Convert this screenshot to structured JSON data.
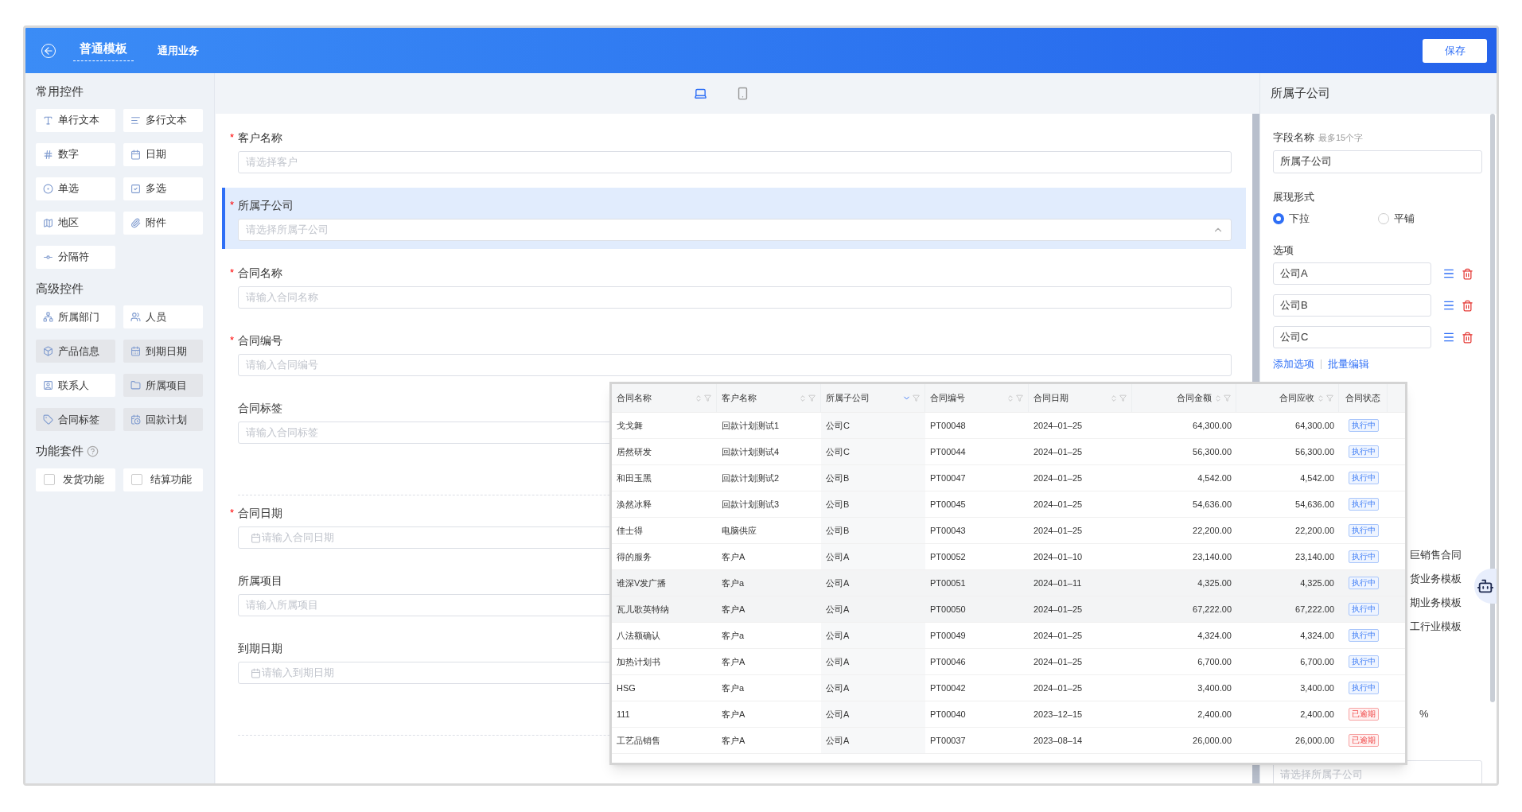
{
  "header": {
    "title": "普通模板",
    "subtitle": "通用业务",
    "save_button": "保存"
  },
  "sidebar": {
    "groups": [
      {
        "title": "常用控件",
        "help": false,
        "kind": "button",
        "items": [
          {
            "label": "单行文本",
            "disabled": false
          },
          {
            "label": "多行文本",
            "disabled": false
          },
          {
            "label": "数字",
            "disabled": false
          },
          {
            "label": "日期",
            "disabled": false
          },
          {
            "label": "单选",
            "disabled": false
          },
          {
            "label": "多选",
            "disabled": false
          },
          {
            "label": "地区",
            "disabled": false
          },
          {
            "label": "附件",
            "disabled": false
          },
          {
            "label": "分隔符",
            "disabled": false
          }
        ]
      },
      {
        "title": "高级控件",
        "help": false,
        "kind": "button",
        "items": [
          {
            "label": "所属部门",
            "disabled": false
          },
          {
            "label": "人员",
            "disabled": false
          },
          {
            "label": "产品信息",
            "disabled": true
          },
          {
            "label": "到期日期",
            "disabled": true
          },
          {
            "label": "联系人",
            "disabled": false
          },
          {
            "label": "所属项目",
            "disabled": true
          },
          {
            "label": "合同标签",
            "disabled": true
          },
          {
            "label": "回款计划",
            "disabled": true
          }
        ]
      },
      {
        "title": "功能套件",
        "help": true,
        "kind": "checkbox",
        "items": [
          {
            "label": "发货功能",
            "checked": false
          },
          {
            "label": "结算功能",
            "checked": false
          }
        ]
      }
    ]
  },
  "view_modes": [
    {
      "kind": "desktop",
      "selected": true
    },
    {
      "kind": "mobile",
      "selected": false
    }
  ],
  "form": {
    "fields": [
      {
        "kind": "input",
        "label": "客户名称",
        "required_mark": "*",
        "placeholder": "请选择客户",
        "selected": false
      },
      {
        "kind": "select",
        "label": "所属子公司",
        "required_mark": "*",
        "placeholder": "请选择所属子公司",
        "selected": true
      },
      {
        "kind": "input",
        "label": "合同名称",
        "required_mark": "*",
        "placeholder": "请输入合同名称",
        "selected": false
      },
      {
        "kind": "input",
        "label": "合同编号",
        "required_mark": "*",
        "placeholder": "请输入合同编号",
        "selected": false
      },
      {
        "kind": "input",
        "label": "合同标签",
        "placeholder": "请输入合同标签",
        "selected": false
      },
      {
        "kind": "divider"
      },
      {
        "kind": "date",
        "label": "合同日期",
        "required_mark": "*",
        "placeholder": "请输入合同日期",
        "selected": false
      },
      {
        "kind": "input",
        "label": "所属项目",
        "placeholder": "请输入所属项目",
        "selected": false
      },
      {
        "kind": "date",
        "label": "到期日期",
        "placeholder": "请输入到期日期",
        "selected": false
      },
      {
        "kind": "divider"
      }
    ]
  },
  "properties": {
    "title": "所属子公司",
    "field_name_label": "字段名称",
    "field_name_hint": "最多15个字",
    "field_name_value": "所属子公司",
    "display_label": "展现形式",
    "display_options": [
      {
        "label": "下拉",
        "selected": true
      },
      {
        "label": "平铺",
        "selected": false
      }
    ],
    "options_label": "选项",
    "options": [
      "公司A",
      "公司B",
      "公司C"
    ],
    "add_option": "添加选项",
    "batch_edit": "批量编辑",
    "partial_texts": [
      "巨销售合同",
      "货业务模板",
      "期业务模板",
      "工行业模板"
    ],
    "partial_percent": "%",
    "bottom_placeholder": "请选择所属子公司"
  },
  "table": {
    "columns": [
      {
        "label": "合同名称",
        "kind": "text",
        "sorted": false
      },
      {
        "label": "客户名称",
        "kind": "text",
        "sorted": false
      },
      {
        "label": "所属子公司",
        "kind": "text",
        "sorted": true
      },
      {
        "label": "合同编号",
        "kind": "text",
        "sorted": false
      },
      {
        "label": "合同日期",
        "kind": "text",
        "sorted": false
      },
      {
        "label": "合同金额",
        "kind": "number",
        "sorted": false
      },
      {
        "label": "合同应收",
        "kind": "number",
        "sorted": false
      },
      {
        "label": "合同状态",
        "kind": "status"
      }
    ],
    "rows": [
      {
        "highlighted": false,
        "cells": [
          "戈戈舞",
          "回款计划测试1",
          "公司C",
          "PT00048",
          "2024–01–25",
          "64,300.00",
          "64,300.00"
        ],
        "status": {
          "text": "执行中",
          "kind": "active"
        }
      },
      {
        "highlighted": false,
        "cells": [
          "居然研发",
          "回款计划测试4",
          "公司C",
          "PT00044",
          "2024–01–25",
          "56,300.00",
          "56,300.00"
        ],
        "status": {
          "text": "执行中",
          "kind": "active"
        }
      },
      {
        "highlighted": false,
        "cells": [
          "和田玉黑",
          "回款计划测试2",
          "公司B",
          "PT00047",
          "2024–01–25",
          "4,542.00",
          "4,542.00"
        ],
        "status": {
          "text": "执行中",
          "kind": "active"
        }
      },
      {
        "highlighted": false,
        "cells": [
          "涣然冰释",
          "回款计划测试3",
          "公司B",
          "PT00045",
          "2024–01–25",
          "54,636.00",
          "54,636.00"
        ],
        "status": {
          "text": "执行中",
          "kind": "active"
        }
      },
      {
        "highlighted": false,
        "cells": [
          "佳士得",
          "电脑供应",
          "公司B",
          "PT00043",
          "2024–01–25",
          "22,200.00",
          "22,200.00"
        ],
        "status": {
          "text": "执行中",
          "kind": "active"
        }
      },
      {
        "highlighted": false,
        "cells": [
          "得的服务",
          "客户A",
          "公司A",
          "PT00052",
          "2024–01–10",
          "23,140.00",
          "23,140.00"
        ],
        "status": {
          "text": "执行中",
          "kind": "active"
        }
      },
      {
        "highlighted": true,
        "cells": [
          "谁深V发广播",
          "客户a",
          "公司A",
          "PT00051",
          "2024–01–11",
          "4,325.00",
          "4,325.00"
        ],
        "status": {
          "text": "执行中",
          "kind": "active"
        }
      },
      {
        "highlighted": true,
        "cells": [
          "瓦儿歌英特纳",
          "客户A",
          "公司A",
          "PT00050",
          "2024–01–25",
          "67,222.00",
          "67,222.00"
        ],
        "status": {
          "text": "执行中",
          "kind": "active"
        }
      },
      {
        "highlighted": false,
        "cells": [
          "八法额确认",
          "客户a",
          "公司A",
          "PT00049",
          "2024–01–25",
          "4,324.00",
          "4,324.00"
        ],
        "status": {
          "text": "执行中",
          "kind": "active"
        }
      },
      {
        "highlighted": false,
        "cells": [
          "加热计划书",
          "客户A",
          "公司A",
          "PT00046",
          "2024–01–25",
          "6,700.00",
          "6,700.00"
        ],
        "status": {
          "text": "执行中",
          "kind": "active"
        }
      },
      {
        "highlighted": false,
        "cells": [
          "HSG",
          "客户a",
          "公司A",
          "PT00042",
          "2024–01–25",
          "3,400.00",
          "3,400.00"
        ],
        "status": {
          "text": "执行中",
          "kind": "active"
        }
      },
      {
        "highlighted": false,
        "cells": [
          "111",
          "客户A",
          "公司A",
          "PT00040",
          "2023–12–15",
          "2,400.00",
          "2,400.00"
        ],
        "status": {
          "text": "已逾期",
          "kind": "overdue"
        }
      },
      {
        "highlighted": false,
        "cells": [
          "工艺品销售",
          "客户A",
          "公司A",
          "PT00037",
          "2023–08–14",
          "26,000.00",
          "26,000.00"
        ],
        "status": {
          "text": "已逾期",
          "kind": "overdue"
        }
      }
    ]
  }
}
